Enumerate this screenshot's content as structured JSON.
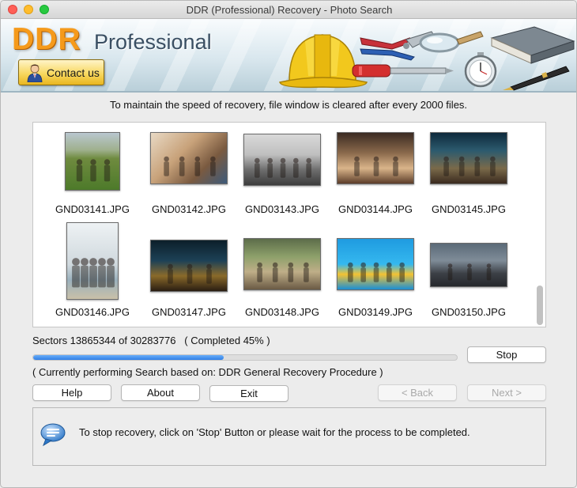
{
  "window": {
    "title": "DDR (Professional) Recovery - Photo Search"
  },
  "banner": {
    "brand_main": "DDR",
    "brand_sub": "Professional",
    "contact_label": "Contact us"
  },
  "info_text": "To maintain the speed of recovery, file window is cleared after every 2000 files.",
  "files": [
    {
      "name": "GND03141.JPG",
      "scene": "park-crowd"
    },
    {
      "name": "GND03142.JPG",
      "scene": "friends-sofa"
    },
    {
      "name": "GND03143.JPG",
      "scene": "group-walking"
    },
    {
      "name": "GND03144.JPG",
      "scene": "cafe-friends"
    },
    {
      "name": "GND03145.JPG",
      "scene": "street-cafe"
    },
    {
      "name": "GND03146.JPG",
      "scene": "beach-couple"
    },
    {
      "name": "GND03147.JPG",
      "scene": "night-camp"
    },
    {
      "name": "GND03148.JPG",
      "scene": "car-outdoor"
    },
    {
      "name": "GND03149.JPG",
      "scene": "pool-float"
    },
    {
      "name": "GND03150.JPG",
      "scene": "city-street"
    }
  ],
  "status": {
    "sectors_text": "Sectors 13865344 of 30283776",
    "completed_text": "( Completed 45% )",
    "progress_fraction": 0.45,
    "procedure_text": "( Currently performing Search based on: DDR General Recovery Procedure )"
  },
  "buttons": {
    "stop": "Stop",
    "help": "Help",
    "about": "About",
    "exit": "Exit",
    "back": "< Back",
    "next": "Next >"
  },
  "message": {
    "icon": "speech-bubble-icon",
    "text": "To stop recovery, click on 'Stop' Button or please wait for the process to be completed."
  },
  "colors": {
    "brand_orange": "#f59a1b",
    "progress_blue": "#2f7fe6"
  }
}
